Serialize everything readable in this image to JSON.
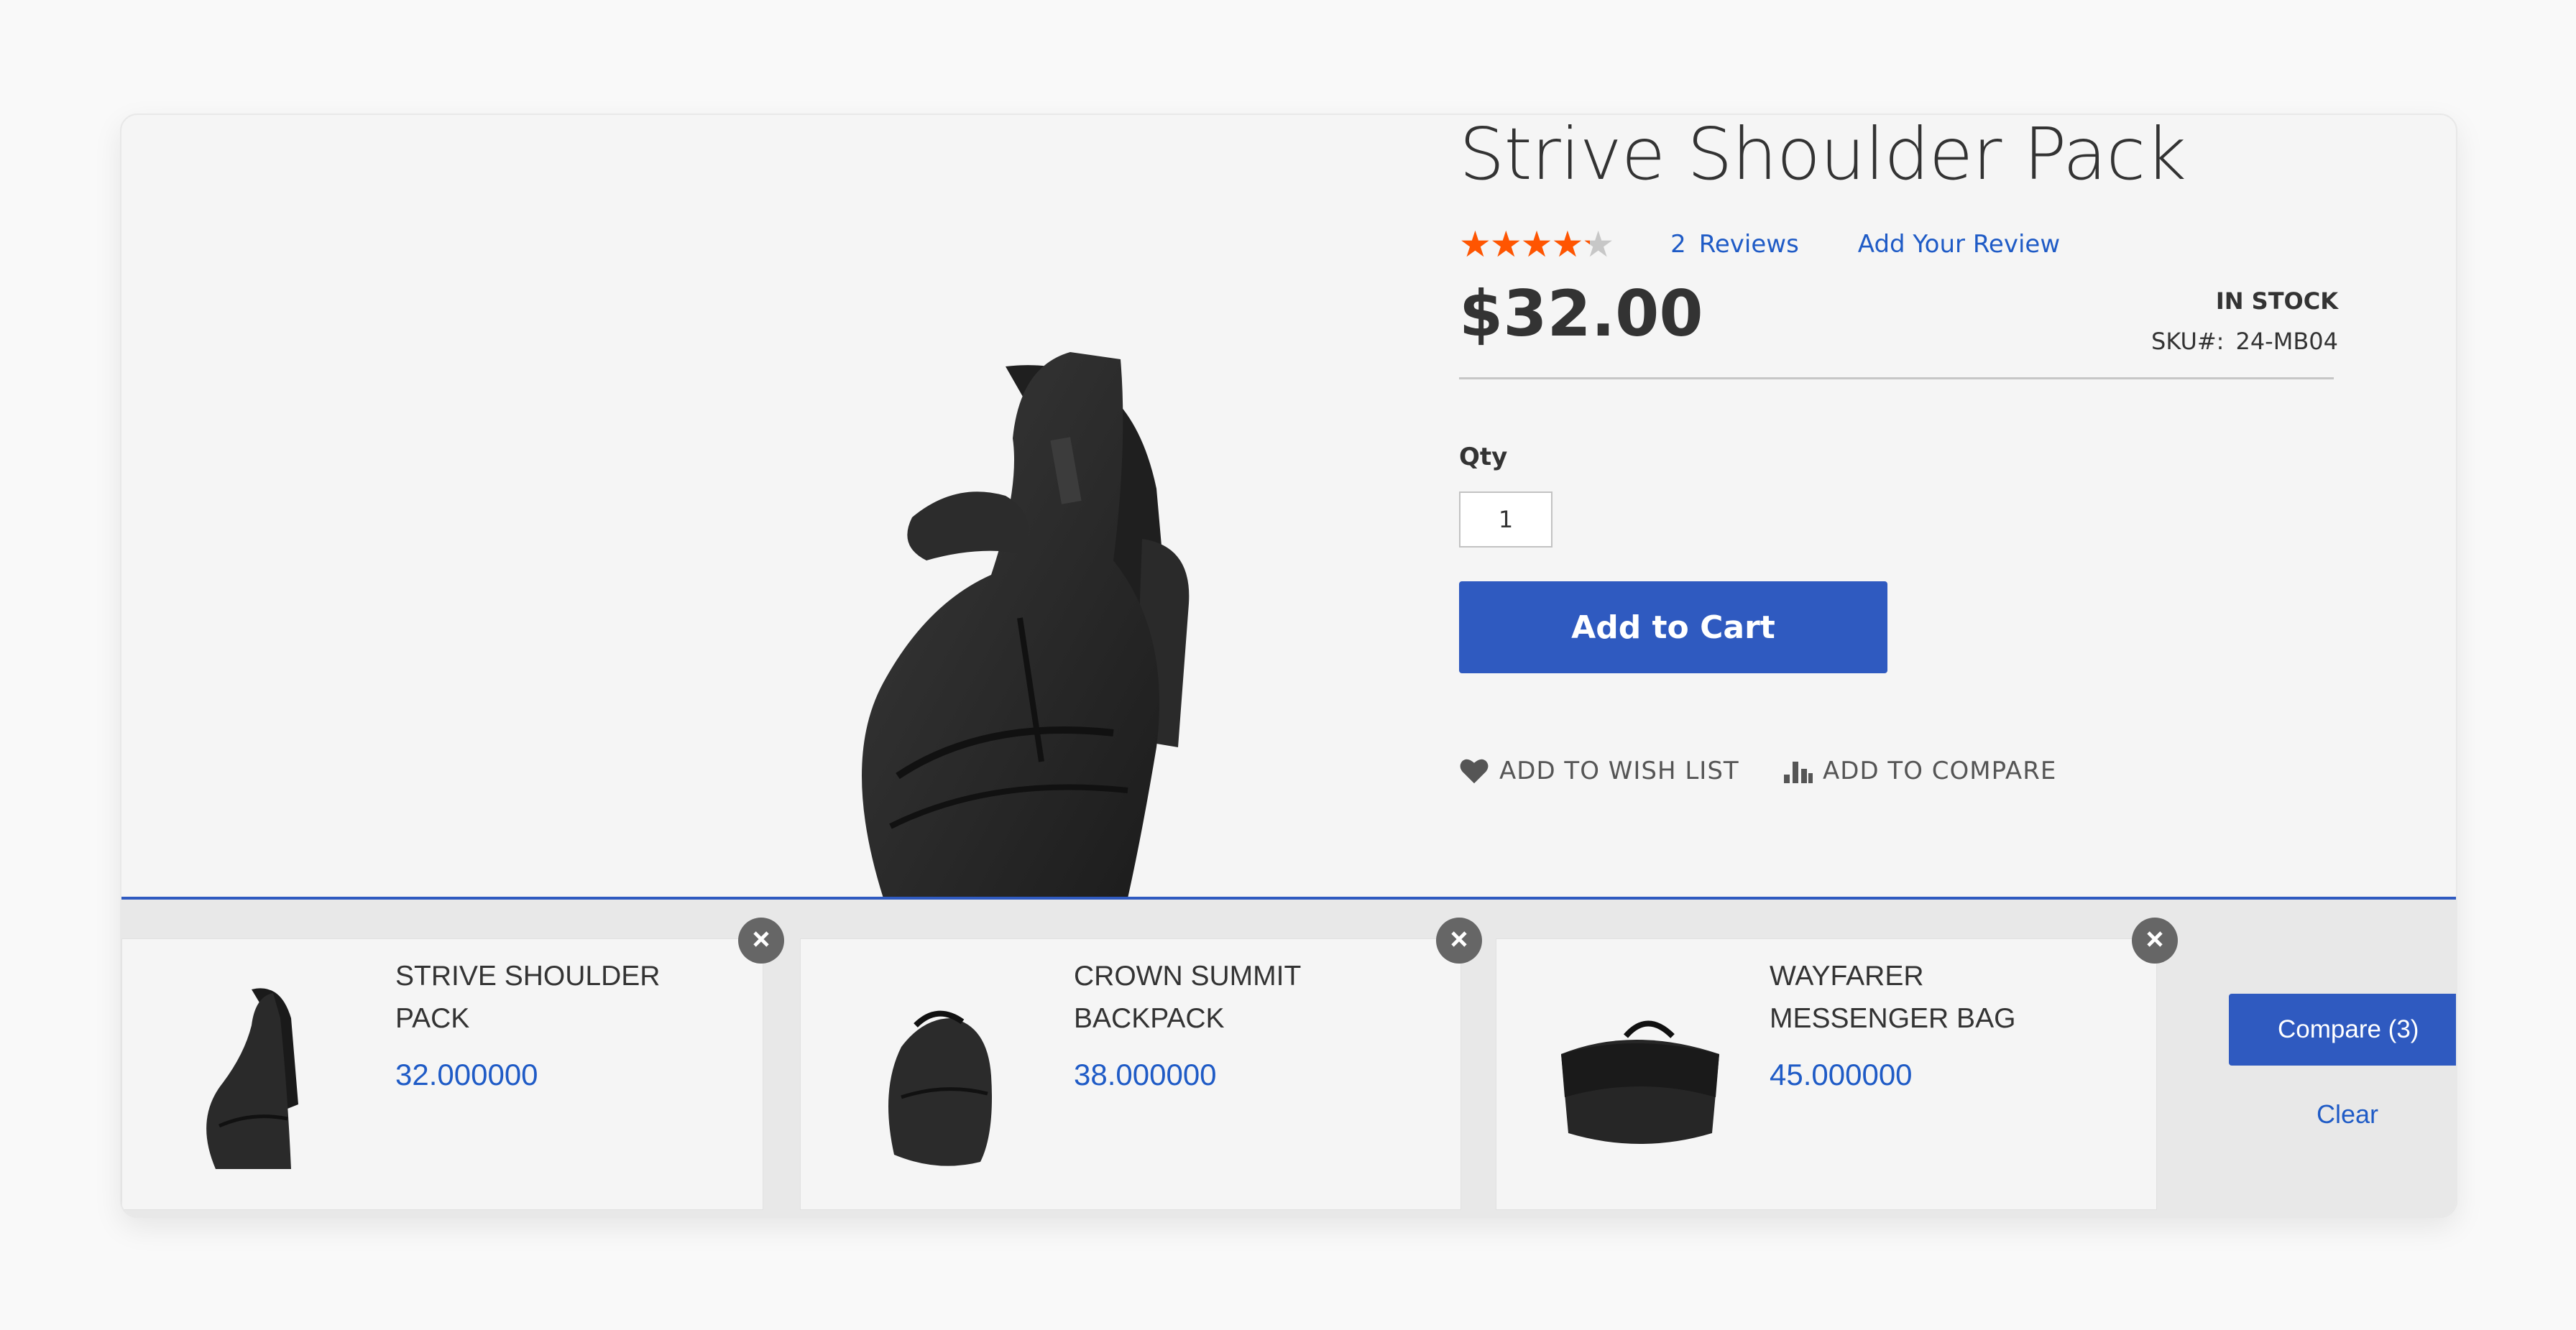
{
  "product": {
    "title": "Strive Shoulder Pack",
    "rating_fraction": 0.85,
    "reviews_count": "2",
    "reviews_label": "Reviews",
    "add_review_label": "Add Your Review",
    "price": "$32.00",
    "stock_status": "IN STOCK",
    "sku_label": "SKU#:",
    "sku_value": "24-MB04",
    "qty_label": "Qty",
    "qty_value": "1",
    "add_to_cart_label": "Add to Cart",
    "wishlist_label": "ADD TO WISH LIST",
    "compare_label": "ADD TO COMPARE"
  },
  "colors": {
    "accent": "#2f5ac0",
    "link": "#1f5bc6",
    "star": "#ff5501",
    "star_empty": "#c7c7c7",
    "text": "#333333"
  },
  "icons": {
    "wishlist": "heart-icon",
    "compare": "bar-chart-icon",
    "remove": "close-icon",
    "rating": "star-icon"
  },
  "compare_bar": {
    "items": [
      {
        "name": "STRIVE SHOULDER PACK",
        "price": "32.000000"
      },
      {
        "name": "CROWN SUMMIT BACKPACK",
        "price": "38.000000"
      },
      {
        "name": "WAYFARER MESSENGER BAG",
        "price": "45.000000"
      }
    ],
    "compare_button_label": "Compare (3)",
    "clear_label": "Clear"
  }
}
